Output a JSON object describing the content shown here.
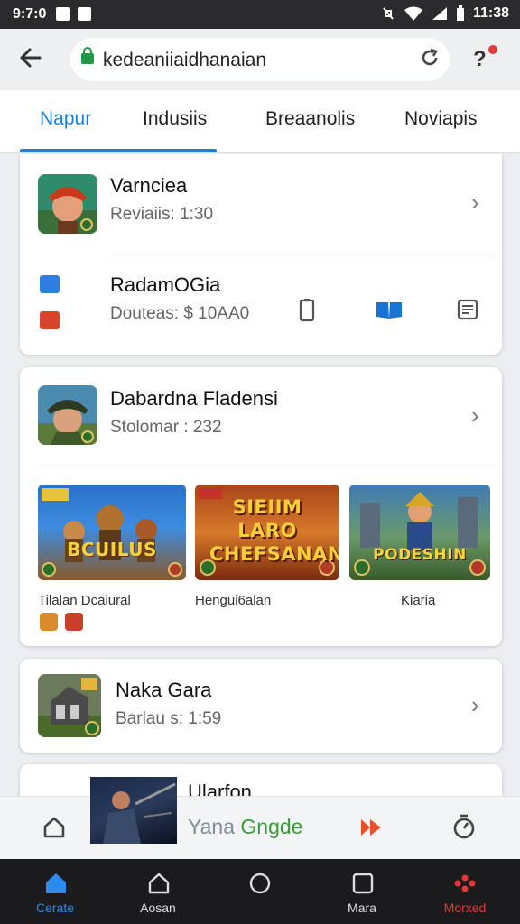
{
  "status": {
    "time": "9:7:0",
    "clock": "11:38"
  },
  "browser": {
    "url": "kedeaniiaidhanaian"
  },
  "tabs": [
    {
      "label": "Napur",
      "active": true
    },
    {
      "label": "Indusiis",
      "active": false
    },
    {
      "label": "Breaanolis",
      "active": false
    },
    {
      "label": "Noviapis",
      "active": false
    }
  ],
  "cards": {
    "first": {
      "item1": {
        "title": "Varnciea",
        "subtitle": "Reviaiis: 1:30"
      },
      "item2": {
        "title": "RadamOGia",
        "subtitle": "Douteas: $ 10AA0"
      }
    },
    "second": {
      "title": "Dabardna Fladensi",
      "subtitle": "Stolomar : 232",
      "tiles": [
        {
          "art_text": "BCUILUS",
          "caption": "Tilalan Dcaiural"
        },
        {
          "art_text": "SIEIIM LARO CHEFSANAN",
          "caption": "Hengui6alan"
        },
        {
          "art_text": "PODESHIN",
          "caption": "Kiaria"
        }
      ]
    },
    "third": {
      "title": "Naka Gara",
      "subtitle": "Barlau s: 1:59"
    },
    "fourth": {
      "title": "Ularfon"
    }
  },
  "minibar": {
    "brand_part1": "Yana ",
    "brand_part2": "Gngde"
  },
  "navbar": [
    {
      "label": "Cerate",
      "icon": "home-icon",
      "active": true
    },
    {
      "label": "Aosan",
      "icon": "house-outline-icon",
      "active": false
    },
    {
      "label": "",
      "icon": "circle-icon",
      "active": false
    },
    {
      "label": "Mara",
      "icon": "square-icon",
      "active": false
    },
    {
      "label": "Morxed",
      "icon": "dots-icon",
      "active": false
    }
  ],
  "colors": {
    "accent": "#1d7fd6",
    "nav_active": "#2a8cf0",
    "nav_alert": "#e03a3a",
    "brand_grey": "#7f8d95",
    "brand_green": "#3a9a3a"
  }
}
